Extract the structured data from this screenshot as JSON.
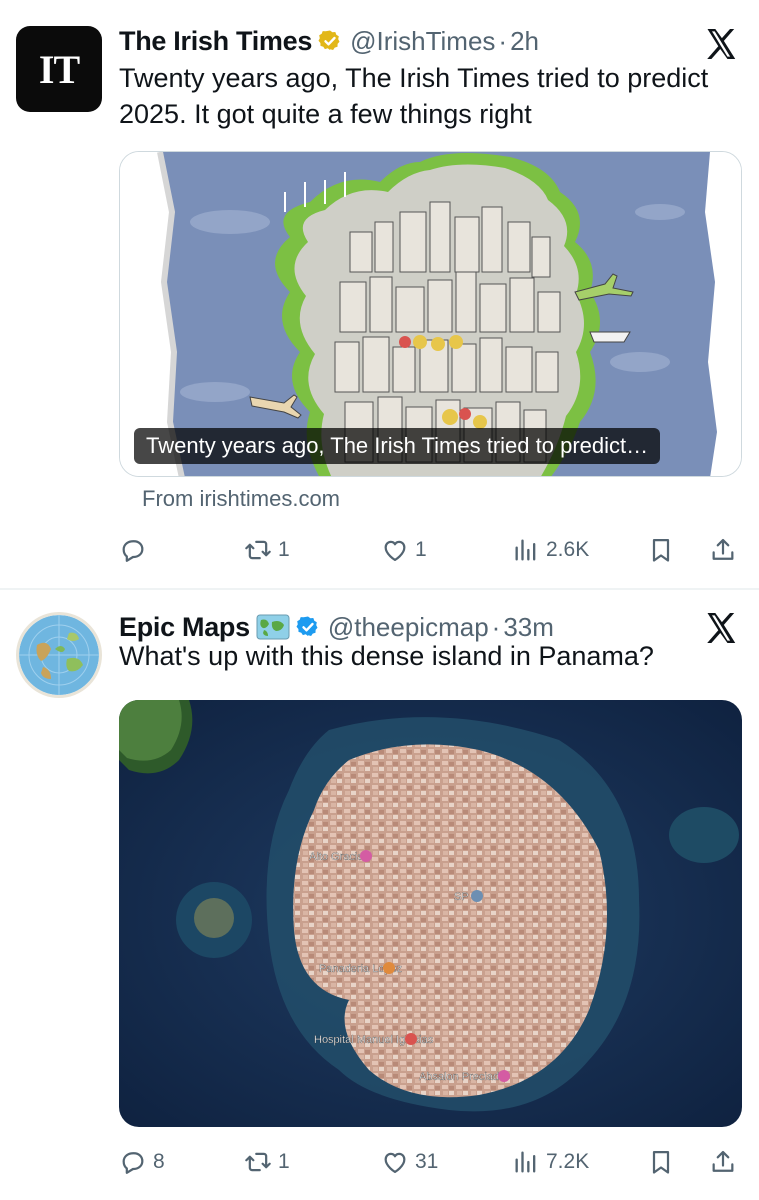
{
  "tweets": [
    {
      "avatar_text": "IT",
      "display_name": "The Irish Times",
      "verified": "gold-check",
      "handle": "@IrishTimes",
      "separator": "·",
      "time": "2h",
      "text": "Twenty years ago, The Irish Times tried to predict 2025. It got quite a few things right",
      "card": {
        "image": "illustrated-map-of-ireland",
        "caption": "Twenty years ago, The Irish Times tried to predict…",
        "source": "From irishtimes.com"
      },
      "actions": {
        "replies": "",
        "retweets": "1",
        "likes": "1",
        "views": "2.6K"
      }
    },
    {
      "avatar_image": "flat-earth-map-globe",
      "display_name": "Epic Maps",
      "name_emoji": "world-map-emoji",
      "verified": "blue-check",
      "handle": "@theepicmap",
      "separator": "·",
      "time": "33m",
      "text": "What's up with this dense island in Panama?",
      "media": {
        "image": "satellite-view-dense-island",
        "labels": [
          "Alto Gracias",
          "SP",
          "Panaderia Lopez",
          "Hospital Manuel Iglesias",
          "Absalon Preciado"
        ]
      },
      "actions": {
        "replies": "8",
        "retweets": "1",
        "likes": "31",
        "views": "7.2K"
      }
    }
  ],
  "colors": {
    "text": "#0f1419",
    "secondary": "#536471",
    "blue_check": "#1d9bf0",
    "gold_check": "#e2b719"
  }
}
